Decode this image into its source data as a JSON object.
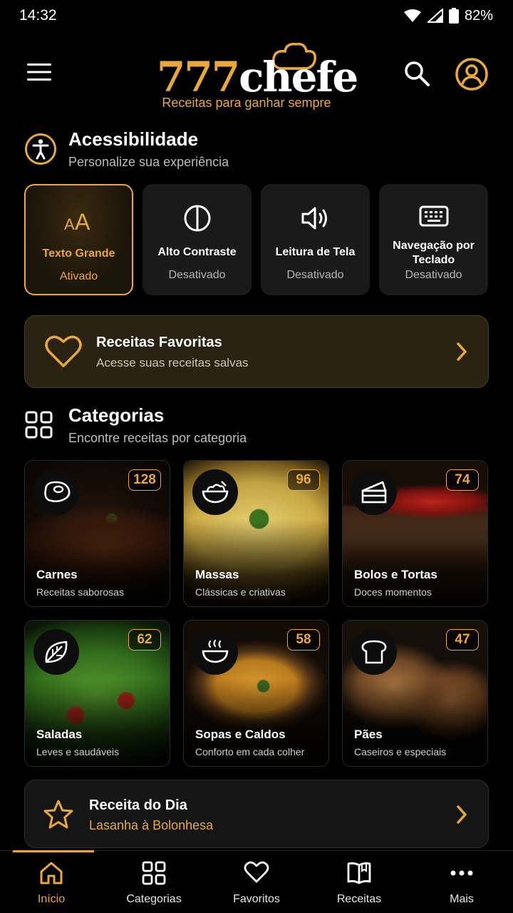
{
  "status": {
    "time": "14:32",
    "battery": "82%"
  },
  "brand": {
    "name_num": "777",
    "name_word": "chefe",
    "tagline": "Receitas para ganhar sempre",
    "accent": "#e8a93a"
  },
  "accessibility": {
    "title": "Acessibilidade",
    "subtitle": "Personalize sua experiência",
    "options": [
      {
        "label": "Texto Grande",
        "status": "Ativado",
        "icon": "text-size-icon",
        "active": true
      },
      {
        "label": "Alto Contraste",
        "status": "Desativado",
        "icon": "contrast-icon",
        "active": false
      },
      {
        "label": "Leitura de Tela",
        "status": "Desativado",
        "icon": "speaker-icon",
        "active": false
      },
      {
        "label": "Navegação por Teclado",
        "status": "Desativado",
        "icon": "keyboard-icon",
        "active": false
      }
    ]
  },
  "favorites": {
    "title": "Receitas Favoritas",
    "subtitle": "Acesse suas receitas salvas"
  },
  "categories": {
    "title": "Categorias",
    "subtitle": "Encontre receitas por categoria",
    "items": [
      {
        "name": "Carnes",
        "desc": "Receitas saborosas",
        "count": "128",
        "icon": "steak-icon"
      },
      {
        "name": "Massas",
        "desc": "Clássicas e criativas",
        "count": "96",
        "icon": "pasta-bowl-icon"
      },
      {
        "name": "Bolos e Tortas",
        "desc": "Doces momentos",
        "count": "74",
        "icon": "cake-icon"
      },
      {
        "name": "Saladas",
        "desc": "Leves e saudáveis",
        "count": "62",
        "icon": "leaf-icon"
      },
      {
        "name": "Sopas e Caldos",
        "desc": "Conforto em cada colher",
        "count": "58",
        "icon": "soup-icon"
      },
      {
        "name": "Pães",
        "desc": "Caseiros e especiais",
        "count": "47",
        "icon": "bread-icon"
      }
    ]
  },
  "recipe_of_day": {
    "title": "Receita do Dia",
    "name": "Lasanha à Bolonhesa"
  },
  "nav": [
    {
      "label": "Início",
      "icon": "home-icon",
      "active": true
    },
    {
      "label": "Categorias",
      "icon": "grid-icon",
      "active": false
    },
    {
      "label": "Favoritos",
      "icon": "heart-icon",
      "active": false
    },
    {
      "label": "Receitas",
      "icon": "book-icon",
      "active": false
    },
    {
      "label": "Mais",
      "icon": "more-icon",
      "active": false
    }
  ]
}
